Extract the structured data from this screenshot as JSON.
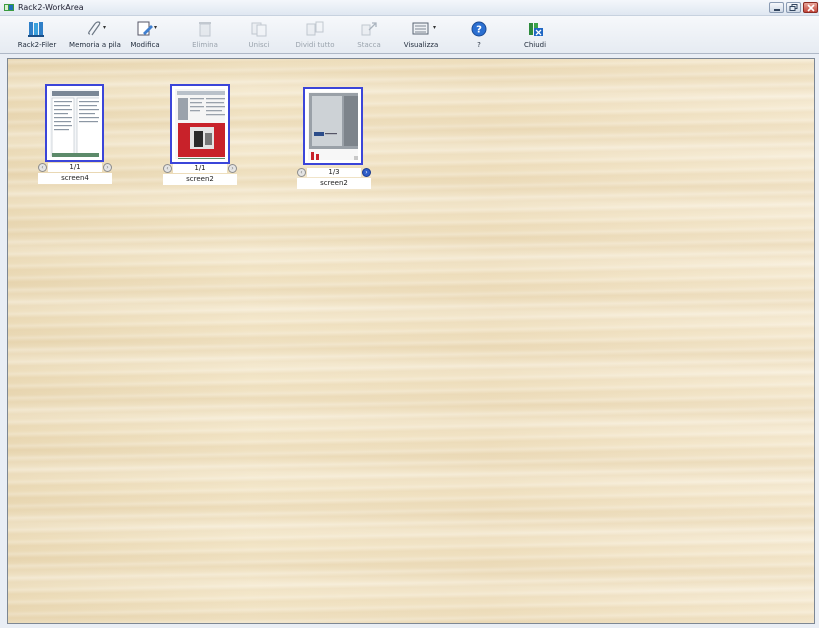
{
  "window": {
    "title": "Rack2-WorkArea"
  },
  "toolbar": {
    "items": [
      {
        "label": "Rack2-Filer",
        "icon": "bookshelf-icon",
        "enabled": true,
        "dropdown": false
      },
      {
        "label": "Memoria a pila",
        "icon": "paperclip-icon",
        "enabled": true,
        "dropdown": true
      },
      {
        "label": "Modifica",
        "icon": "edit-page-icon",
        "enabled": true,
        "dropdown": true
      },
      {
        "label": "Elimina",
        "icon": "trash-icon",
        "enabled": false,
        "dropdown": false
      },
      {
        "label": "Unisci",
        "icon": "merge-icon",
        "enabled": false,
        "dropdown": false
      },
      {
        "label": "Dividi tutto",
        "icon": "split-all-icon",
        "enabled": false,
        "dropdown": false
      },
      {
        "label": "Stacca",
        "icon": "detach-icon",
        "enabled": false,
        "dropdown": false
      },
      {
        "label": "Visualizza",
        "icon": "view-grid-icon",
        "enabled": true,
        "dropdown": true
      },
      {
        "label": "?",
        "icon": "help-icon",
        "enabled": true,
        "dropdown": false
      },
      {
        "label": "Chiudi",
        "icon": "close-workarea-icon",
        "enabled": true,
        "dropdown": false
      }
    ]
  },
  "documents": [
    {
      "name": "screen4",
      "pages": "1/1"
    },
    {
      "name": "screen2",
      "pages": "1/1"
    },
    {
      "name": "screen2",
      "pages": "1/3"
    }
  ],
  "colors": {
    "selection_border": "#3b45d9",
    "wood_background": "#f1e3c4",
    "page_nav_active": "#2f5ec8"
  }
}
